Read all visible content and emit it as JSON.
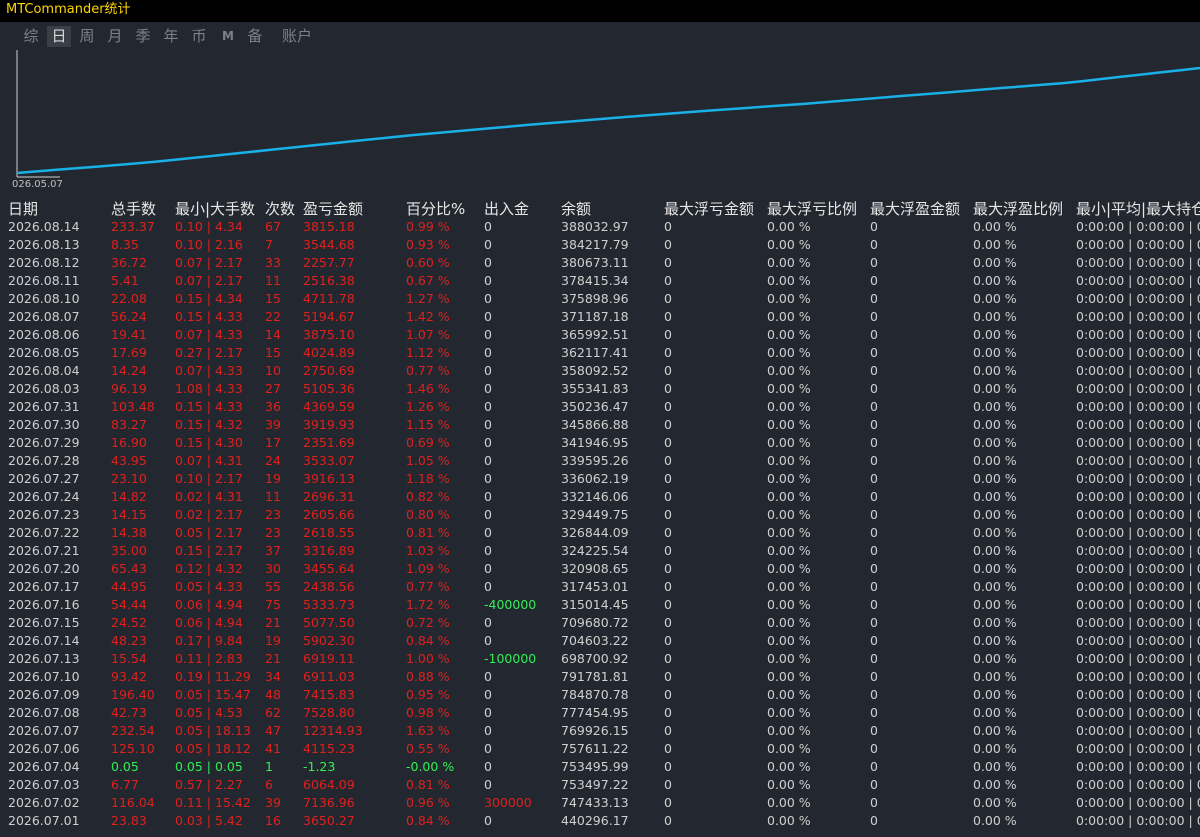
{
  "app": {
    "title": "MTCommander统计"
  },
  "tabs": [
    {
      "label": "综",
      "active": false
    },
    {
      "label": "日",
      "active": true
    },
    {
      "label": "周",
      "active": false
    },
    {
      "label": "月",
      "active": false
    },
    {
      "label": "季",
      "active": false
    },
    {
      "label": "年",
      "active": false
    },
    {
      "label": "币",
      "active": false
    },
    {
      "label": "M",
      "active": false
    },
    {
      "label": "备",
      "active": false
    },
    {
      "label": "账户",
      "active": false
    }
  ],
  "chart_data": {
    "type": "line",
    "start_label": "026.05.07",
    "line_color": "#1ab0e8",
    "series": [
      {
        "values": [
          0,
          0.1,
          0.23,
          0.36,
          0.47,
          0.57,
          0.66,
          0.76,
          0.86,
          1.0
        ]
      }
    ]
  },
  "columns": [
    "日期",
    "总手数",
    "最小|大手数",
    "次数",
    "盈亏金额",
    "百分比%",
    "出入金",
    "余额",
    "最大浮亏金额",
    "最大浮亏比例",
    "最大浮盈金额",
    "最大浮盈比例",
    "最小|平均|最大持仓"
  ],
  "colors": {
    "loss_profit": "#e0201c",
    "positive": "#33ee55",
    "neutral": "#cfcfcf",
    "panel_bg": "#232830"
  },
  "rows": [
    [
      "2026.08.14",
      "233.37",
      "0.10 | 4.34",
      "67",
      "3815.18",
      "0.99 %",
      "0",
      "388032.97",
      "0",
      "0.00 %",
      "0",
      "0.00 %",
      "0:00:00 | 0:00:00 | 0:"
    ],
    [
      "2026.08.13",
      "8.35",
      "0.10 | 2.16",
      "7",
      "3544.68",
      "0.93 %",
      "0",
      "384217.79",
      "0",
      "0.00 %",
      "0",
      "0.00 %",
      "0:00:00 | 0:00:00 | 0:"
    ],
    [
      "2026.08.12",
      "36.72",
      "0.07 | 2.17",
      "33",
      "2257.77",
      "0.60 %",
      "0",
      "380673.11",
      "0",
      "0.00 %",
      "0",
      "0.00 %",
      "0:00:00 | 0:00:00 | 0:"
    ],
    [
      "2026.08.11",
      "5.41",
      "0.07 | 2.17",
      "11",
      "2516.38",
      "0.67 %",
      "0",
      "378415.34",
      "0",
      "0.00 %",
      "0",
      "0.00 %",
      "0:00:00 | 0:00:00 | 0:"
    ],
    [
      "2026.08.10",
      "22.08",
      "0.15 | 4.34",
      "15",
      "4711.78",
      "1.27 %",
      "0",
      "375898.96",
      "0",
      "0.00 %",
      "0",
      "0.00 %",
      "0:00:00 | 0:00:00 | 0:"
    ],
    [
      "2026.08.07",
      "56.24",
      "0.15 | 4.33",
      "22",
      "5194.67",
      "1.42 %",
      "0",
      "371187.18",
      "0",
      "0.00 %",
      "0",
      "0.00 %",
      "0:00:00 | 0:00:00 | 0:"
    ],
    [
      "2026.08.06",
      "19.41",
      "0.07 | 4.33",
      "14",
      "3875.10",
      "1.07 %",
      "0",
      "365992.51",
      "0",
      "0.00 %",
      "0",
      "0.00 %",
      "0:00:00 | 0:00:00 | 0:"
    ],
    [
      "2026.08.05",
      "17.69",
      "0.27 | 2.17",
      "15",
      "4024.89",
      "1.12 %",
      "0",
      "362117.41",
      "0",
      "0.00 %",
      "0",
      "0.00 %",
      "0:00:00 | 0:00:00 | 0:"
    ],
    [
      "2026.08.04",
      "14.24",
      "0.07 | 4.33",
      "10",
      "2750.69",
      "0.77 %",
      "0",
      "358092.52",
      "0",
      "0.00 %",
      "0",
      "0.00 %",
      "0:00:00 | 0:00:00 | 0:"
    ],
    [
      "2026.08.03",
      "96.19",
      "1.08 | 4.33",
      "27",
      "5105.36",
      "1.46 %",
      "0",
      "355341.83",
      "0",
      "0.00 %",
      "0",
      "0.00 %",
      "0:00:00 | 0:00:00 | 0:"
    ],
    [
      "2026.07.31",
      "103.48",
      "0.15 | 4.33",
      "36",
      "4369.59",
      "1.26 %",
      "0",
      "350236.47",
      "0",
      "0.00 %",
      "0",
      "0.00 %",
      "0:00:00 | 0:00:00 | 0:"
    ],
    [
      "2026.07.30",
      "83.27",
      "0.15 | 4.32",
      "39",
      "3919.93",
      "1.15 %",
      "0",
      "345866.88",
      "0",
      "0.00 %",
      "0",
      "0.00 %",
      "0:00:00 | 0:00:00 | 0:"
    ],
    [
      "2026.07.29",
      "16.90",
      "0.15 | 4.30",
      "17",
      "2351.69",
      "0.69 %",
      "0",
      "341946.95",
      "0",
      "0.00 %",
      "0",
      "0.00 %",
      "0:00:00 | 0:00:00 | 0:"
    ],
    [
      "2026.07.28",
      "43.95",
      "0.07 | 4.31",
      "24",
      "3533.07",
      "1.05 %",
      "0",
      "339595.26",
      "0",
      "0.00 %",
      "0",
      "0.00 %",
      "0:00:00 | 0:00:00 | 0:"
    ],
    [
      "2026.07.27",
      "23.10",
      "0.10 | 2.17",
      "19",
      "3916.13",
      "1.18 %",
      "0",
      "336062.19",
      "0",
      "0.00 %",
      "0",
      "0.00 %",
      "0:00:00 | 0:00:00 | 0:"
    ],
    [
      "2026.07.24",
      "14.82",
      "0.02 | 4.31",
      "11",
      "2696.31",
      "0.82 %",
      "0",
      "332146.06",
      "0",
      "0.00 %",
      "0",
      "0.00 %",
      "0:00:00 | 0:00:00 | 0:"
    ],
    [
      "2026.07.23",
      "14.15",
      "0.02 | 2.17",
      "23",
      "2605.66",
      "0.80 %",
      "0",
      "329449.75",
      "0",
      "0.00 %",
      "0",
      "0.00 %",
      "0:00:00 | 0:00:00 | 0:"
    ],
    [
      "2026.07.22",
      "14.38",
      "0.05 | 2.17",
      "23",
      "2618.55",
      "0.81 %",
      "0",
      "326844.09",
      "0",
      "0.00 %",
      "0",
      "0.00 %",
      "0:00:00 | 0:00:00 | 0:"
    ],
    [
      "2026.07.21",
      "35.00",
      "0.15 | 2.17",
      "37",
      "3316.89",
      "1.03 %",
      "0",
      "324225.54",
      "0",
      "0.00 %",
      "0",
      "0.00 %",
      "0:00:00 | 0:00:00 | 0:"
    ],
    [
      "2026.07.20",
      "65.43",
      "0.12 | 4.32",
      "30",
      "3455.64",
      "1.09 %",
      "0",
      "320908.65",
      "0",
      "0.00 %",
      "0",
      "0.00 %",
      "0:00:00 | 0:00:00 | 0:"
    ],
    [
      "2026.07.17",
      "44.95",
      "0.05 | 4.33",
      "55",
      "2438.56",
      "0.77 %",
      "0",
      "317453.01",
      "0",
      "0.00 %",
      "0",
      "0.00 %",
      "0:00:00 | 0:00:00 | 0:"
    ],
    [
      "2026.07.16",
      "54.44",
      "0.06 | 4.94",
      "75",
      "5333.73",
      "1.72 %",
      "-400000",
      "315014.45",
      "0",
      "0.00 %",
      "0",
      "0.00 %",
      "0:00:00 | 0:00:00 | 0:"
    ],
    [
      "2026.07.15",
      "24.52",
      "0.06 | 4.94",
      "21",
      "5077.50",
      "0.72 %",
      "0",
      "709680.72",
      "0",
      "0.00 %",
      "0",
      "0.00 %",
      "0:00:00 | 0:00:00 | 0:"
    ],
    [
      "2026.07.14",
      "48.23",
      "0.17 | 9.84",
      "19",
      "5902.30",
      "0.84 %",
      "0",
      "704603.22",
      "0",
      "0.00 %",
      "0",
      "0.00 %",
      "0:00:00 | 0:00:00 | 0:"
    ],
    [
      "2026.07.13",
      "15.54",
      "0.11 | 2.83",
      "21",
      "6919.11",
      "1.00 %",
      "-100000",
      "698700.92",
      "0",
      "0.00 %",
      "0",
      "0.00 %",
      "0:00:00 | 0:00:00 | 0:"
    ],
    [
      "2026.07.10",
      "93.42",
      "0.19 | 11.29",
      "34",
      "6911.03",
      "0.88 %",
      "0",
      "791781.81",
      "0",
      "0.00 %",
      "0",
      "0.00 %",
      "0:00:00 | 0:00:00 | 0:"
    ],
    [
      "2026.07.09",
      "196.40",
      "0.05 | 15.47",
      "48",
      "7415.83",
      "0.95 %",
      "0",
      "784870.78",
      "0",
      "0.00 %",
      "0",
      "0.00 %",
      "0:00:00 | 0:00:00 | 0:"
    ],
    [
      "2026.07.08",
      "42.73",
      "0.05 | 4.53",
      "62",
      "7528.80",
      "0.98 %",
      "0",
      "777454.95",
      "0",
      "0.00 %",
      "0",
      "0.00 %",
      "0:00:00 | 0:00:00 | 0:"
    ],
    [
      "2026.07.07",
      "232.54",
      "0.05 | 18.13",
      "47",
      "12314.93",
      "1.63 %",
      "0",
      "769926.15",
      "0",
      "0.00 %",
      "0",
      "0.00 %",
      "0:00:00 | 0:00:00 | 0:"
    ],
    [
      "2026.07.06",
      "125.10",
      "0.05 | 18.12",
      "41",
      "4115.23",
      "0.55 %",
      "0",
      "757611.22",
      "0",
      "0.00 %",
      "0",
      "0.00 %",
      "0:00:00 | 0:00:00 | 0:"
    ],
    [
      "2026.07.04",
      "0.05",
      "0.05 | 0.05",
      "1",
      "-1.23",
      "-0.00 %",
      "0",
      "753495.99",
      "0",
      "0.00 %",
      "0",
      "0.00 %",
      "0:00:00 | 0:00:00 | 0:"
    ],
    [
      "2026.07.03",
      "6.77",
      "0.57 | 2.27",
      "6",
      "6064.09",
      "0.81 %",
      "0",
      "753497.22",
      "0",
      "0.00 %",
      "0",
      "0.00 %",
      "0:00:00 | 0:00:00 | 0:"
    ],
    [
      "2026.07.02",
      "116.04",
      "0.11 | 15.42",
      "39",
      "7136.96",
      "0.96 %",
      "300000",
      "747433.13",
      "0",
      "0.00 %",
      "0",
      "0.00 %",
      "0:00:00 | 0:00:00 | 0:"
    ],
    [
      "2026.07.01",
      "23.83",
      "0.03 | 5.42",
      "16",
      "3650.27",
      "0.84 %",
      "0",
      "440296.17",
      "0",
      "0.00 %",
      "0",
      "0.00 %",
      "0:00:00 | 0:00:00 | 0:"
    ]
  ]
}
